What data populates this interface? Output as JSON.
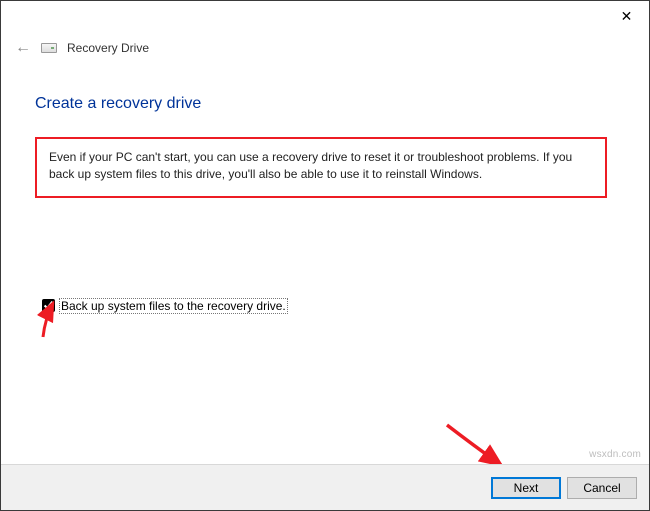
{
  "window": {
    "title": "Recovery Drive"
  },
  "page": {
    "heading": "Create a recovery drive",
    "description": "Even if your PC can't start, you can use a recovery drive to reset it or troubleshoot problems. If you back up system files to this drive, you'll also be able to use it to reinstall Windows."
  },
  "checkbox": {
    "label": "Back up system files to the recovery drive.",
    "checked": true
  },
  "buttons": {
    "next": "Next",
    "cancel": "Cancel"
  },
  "watermark": "wsxdn.com"
}
